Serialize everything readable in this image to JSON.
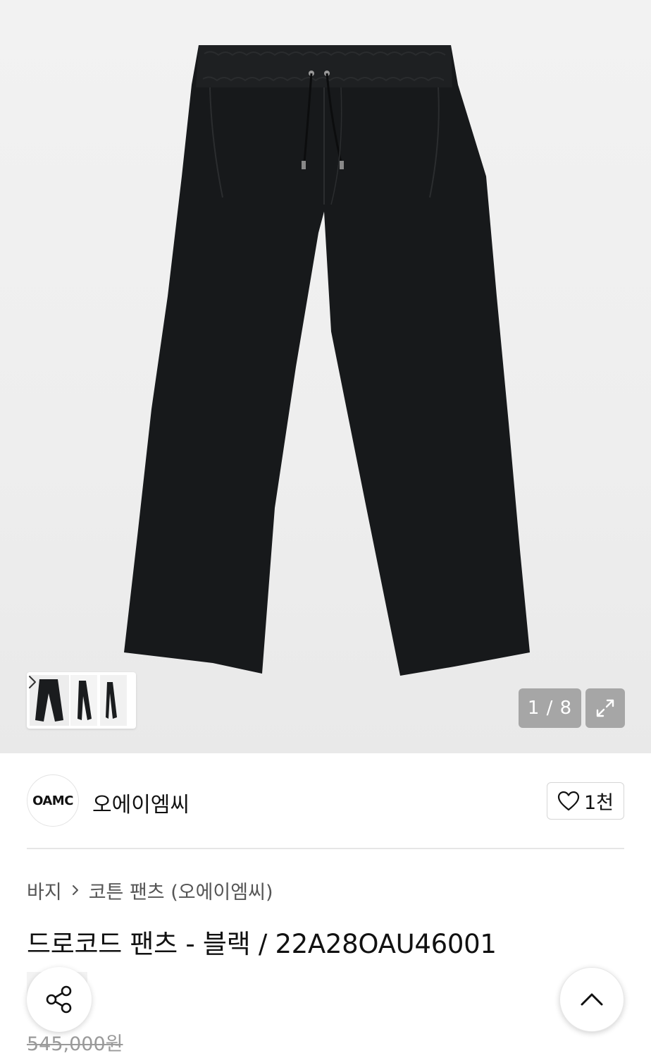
{
  "gallery": {
    "image_alt": "drawcord pants black",
    "current_page": "1 / 8"
  },
  "brand": {
    "logo_text": "OAMC",
    "name": "오에이엠씨",
    "like_count": "1천"
  },
  "breadcrumb": {
    "items": [
      "바지",
      "코튼 팬츠 (오에이엠씨)"
    ]
  },
  "product": {
    "title": "드로코드 팬츠 - 블랙 / 22A28OAU46001",
    "original_price": "545,000원"
  },
  "icons": {
    "thumb_next": "chevron-right-icon",
    "expand": "expand-icon",
    "like": "heart-icon",
    "share": "share-icon",
    "scroll_top": "chevron-up-icon"
  }
}
